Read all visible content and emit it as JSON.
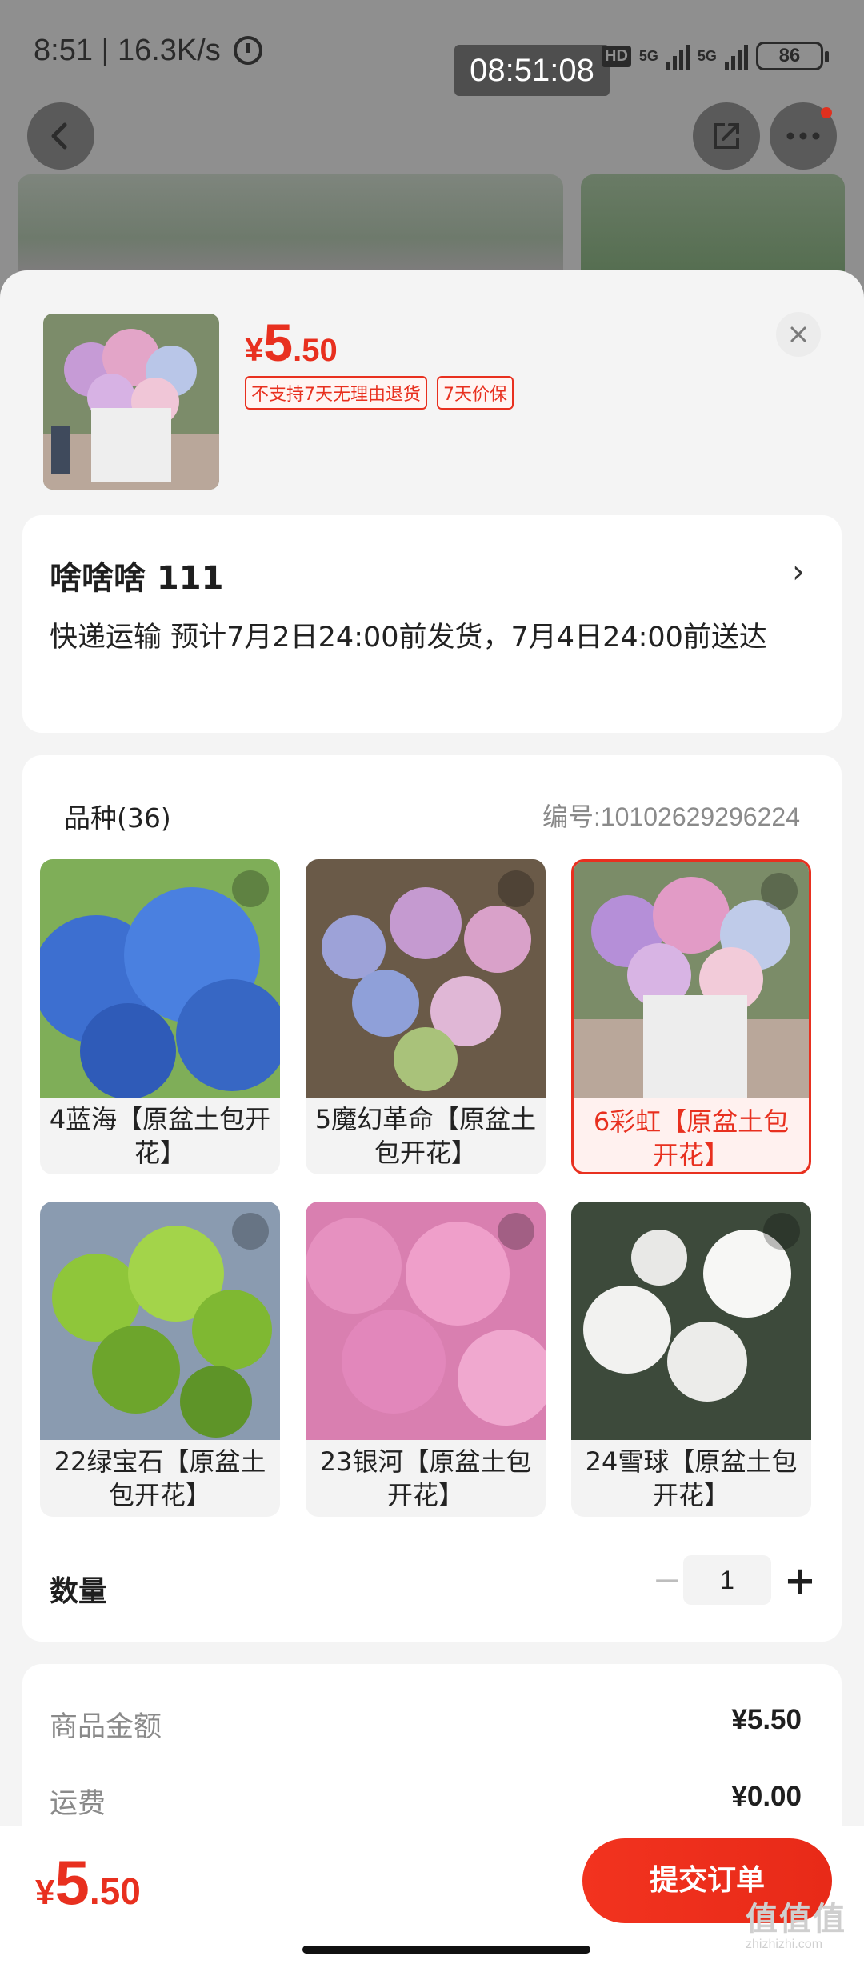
{
  "status_bar": {
    "time_speed": "8:51 | 16.3K/s",
    "time_overlay": "08:51:08",
    "hd": "HD",
    "net1": "5G",
    "net2": "5G",
    "battery": "86"
  },
  "product": {
    "price_currency": "¥",
    "price_int": "5",
    "price_dec": ".50",
    "tags": [
      "不支持7天无理由退货",
      "7天价保"
    ]
  },
  "address": {
    "name": "啥啥啥  111",
    "shipping": "快递运输 预计7月2日24:00前发货，7月4日24:00前送达"
  },
  "spec": {
    "title": "品种(36)",
    "code": "编号:10102629296224",
    "variants": [
      {
        "label": "4蓝海【原盆土包开花】",
        "selected": false
      },
      {
        "label": "5魔幻革命【原盆土包开花】",
        "selected": false
      },
      {
        "label": "6彩虹【原盆土包开花】",
        "selected": true
      },
      {
        "label": "22绿宝石【原盆土包开花】",
        "selected": false
      },
      {
        "label": "23银河【原盆土包开花】",
        "selected": false
      },
      {
        "label": "24雪球【原盆土包开花】",
        "selected": false
      }
    ]
  },
  "quantity": {
    "label": "数量",
    "minus": "−",
    "value": "1",
    "plus": "+"
  },
  "cost": {
    "goods_label": "商品金额",
    "goods_value": "¥5.50",
    "shipping_label": "运费",
    "shipping_value": "¥0.00"
  },
  "bottom": {
    "price_currency": "¥",
    "price_int": "5",
    "price_dec": ".50",
    "submit_label": "提交订单",
    "watermark": "值值值",
    "watermark_sub": "zhizhizhi.com"
  },
  "colors": {
    "accent": "#e8301f",
    "sheet_bg": "#f4f4f4",
    "card_bg": "#ffffff"
  }
}
